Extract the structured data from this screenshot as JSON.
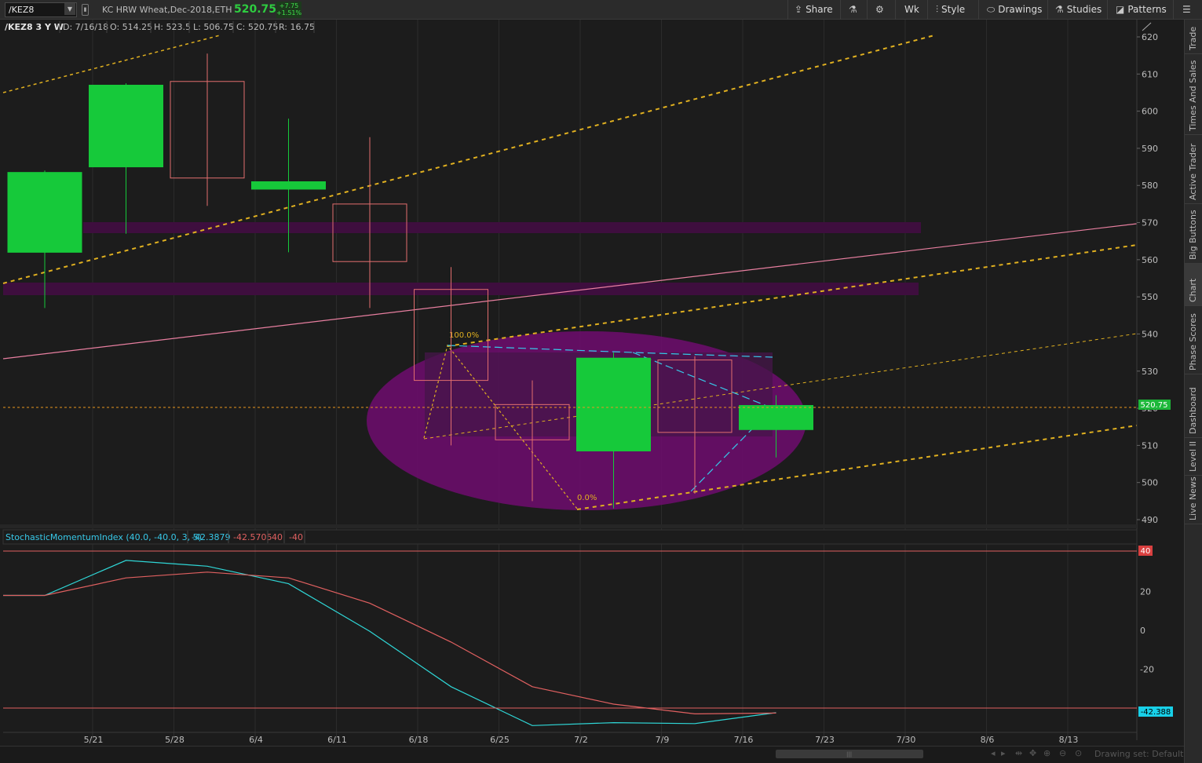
{
  "toolbar": {
    "symbol": "/KEZ8",
    "description": "KC HRW Wheat,Dec-2018,ETH",
    "last": "520.75",
    "change": "+7.75",
    "change_pct": "+1.51%",
    "share": "Share",
    "aggregation": "Wk",
    "style": "Style",
    "drawings": "Drawings",
    "studies": "Studies",
    "patterns": "Patterns"
  },
  "side_tabs": [
    "Trade",
    "Times And Sales",
    "Active Trader",
    "Big Buttons",
    "Chart",
    "Phase Scores",
    "Dashboard",
    "Level II",
    "Live News"
  ],
  "active_tab": "Chart",
  "bottom": {
    "drawing_set": "Drawing set: Default"
  },
  "chart_data": [
    {
      "type": "candlestick",
      "header": {
        "title": "/KEZ8 3 Y W",
        "date": "D: 7/16/18",
        "open": "O: 514.25",
        "high": "H: 523.5",
        "low": "L: 506.75",
        "close": "C: 520.75",
        "range": "R: 16.75"
      },
      "y_ticks": [
        490,
        500,
        510,
        520,
        530,
        540,
        550,
        560,
        570,
        580,
        590,
        600,
        610,
        620
      ],
      "ylim": [
        488,
        621
      ],
      "x_labels": [
        "5/21",
        "5/28",
        "6/4",
        "6/11",
        "6/18",
        "6/25",
        "7/2",
        "7/9",
        "7/16",
        "7/23",
        "7/30",
        "8/6",
        "8/13"
      ],
      "last_price_label": "520.75",
      "candles": [
        {
          "open": 562,
          "close": 583.5,
          "high": 584,
          "low": 547
        },
        {
          "open": 585,
          "close": 607,
          "high": 607.5,
          "low": 567
        },
        {
          "open": 608,
          "close": 582,
          "high": 615.5,
          "low": 574.5
        },
        {
          "open": 579,
          "close": 581,
          "high": 598,
          "low": 562
        },
        {
          "open": 575,
          "close": 559.5,
          "high": 593,
          "low": 547
        },
        {
          "open": 552,
          "close": 527.5,
          "high": 558,
          "low": 510
        },
        {
          "open": 521,
          "close": 511.5,
          "high": 527.5,
          "low": 495
        },
        {
          "open": 508.5,
          "close": 533.5,
          "high": 535,
          "low": 493
        },
        {
          "open": 533,
          "close": 513.5,
          "high": 534,
          "low": 497
        },
        {
          "open": 514.25,
          "close": 520.75,
          "high": 523.5,
          "low": 506.75
        }
      ],
      "fib_labels": [
        "100.0%",
        "0.0%"
      ]
    },
    {
      "type": "line",
      "header": {
        "name": "StochasticMomentumIndex (40.0, -40.0, 3, 5)",
        "smi": "-42.3879",
        "avg": "-42.5705",
        "over_bought": "40",
        "over_sold": "-40"
      },
      "y_ticks": [
        -20,
        0,
        20
      ],
      "ylim": [
        -56,
        48
      ],
      "level_labels": [
        "40",
        "-42.388"
      ],
      "series": [
        {
          "color": "#2fd6d6",
          "values": [
            18,
            18,
            36,
            33,
            24,
            -0.5,
            -29,
            -49,
            -47.5,
            -48,
            -42.4
          ]
        },
        {
          "color": "#e06060",
          "values": [
            18,
            18,
            27,
            30,
            27,
            14,
            -6,
            -29,
            -38,
            -43,
            -42.6
          ]
        }
      ]
    }
  ]
}
